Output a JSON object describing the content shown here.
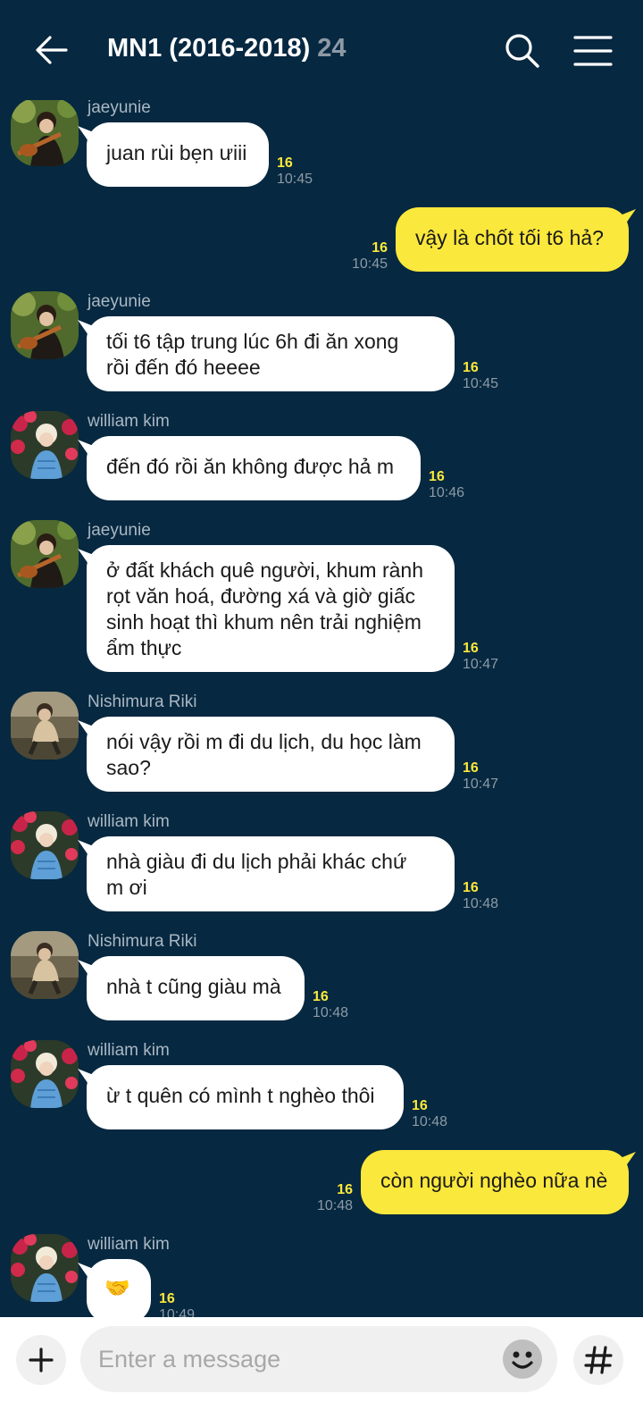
{
  "header": {
    "title": "MN1 (2016-2018)",
    "member_count": "24"
  },
  "colors": {
    "background": "#062840",
    "incoming_bubble": "#ffffff",
    "outgoing_bubble": "#fbe83c",
    "unread": "#fbe83c"
  },
  "messages": [
    {
      "sender": "jaeyunie",
      "text": "juan rùi bẹn ưiii",
      "unread": "16",
      "time": "10:45"
    },
    {
      "text": "vậy là chốt tối t6 hả?",
      "unread": "16",
      "time": "10:45"
    },
    {
      "sender": "jaeyunie",
      "lines": [
        "tối t6 tập trung lúc 6h đi ăn xong",
        "rồi đến đó heeee"
      ],
      "unread": "16",
      "time": "10:45"
    },
    {
      "sender": "william kim",
      "text": "đến đó rồi ăn không được hả m",
      "unread": "16",
      "time": "10:46"
    },
    {
      "sender": "jaeyunie",
      "lines": [
        "ở đất khách quê người, khum rành",
        "rọt văn hoá, đường xá và giờ giấc",
        "sinh hoạt thì khum nên trải nghiệm",
        "ẩm thực"
      ],
      "unread": "16",
      "time": "10:47"
    },
    {
      "sender": "Nishimura Riki",
      "lines": [
        "nói vậy rồi m đi du lịch, du học làm",
        "sao?"
      ],
      "unread": "16",
      "time": "10:47"
    },
    {
      "sender": "william kim",
      "lines": [
        "nhà giàu đi du lịch phải khác chứ",
        "m ơi"
      ],
      "unread": "16",
      "time": "10:48"
    },
    {
      "sender": "Nishimura Riki",
      "text": "nhà t cũng giàu mà",
      "unread": "16",
      "time": "10:48"
    },
    {
      "sender": "william kim",
      "text": "ừ t quên có mình t nghèo thôi",
      "unread": "16",
      "time": "10:48"
    },
    {
      "text": "còn người nghèo nữa nè",
      "unread": "16",
      "time": "10:48"
    },
    {
      "sender": "william kim",
      "emoji": "🤝",
      "unread": "16",
      "time": "10:49"
    }
  ],
  "input": {
    "placeholder": "Enter a message"
  },
  "icons": {
    "back": "back-arrow-icon",
    "search": "search-icon",
    "menu": "hamburger-menu-icon",
    "attach": "plus-icon",
    "emoji": "emoticon-icon",
    "hashtag": "hash-icon"
  }
}
